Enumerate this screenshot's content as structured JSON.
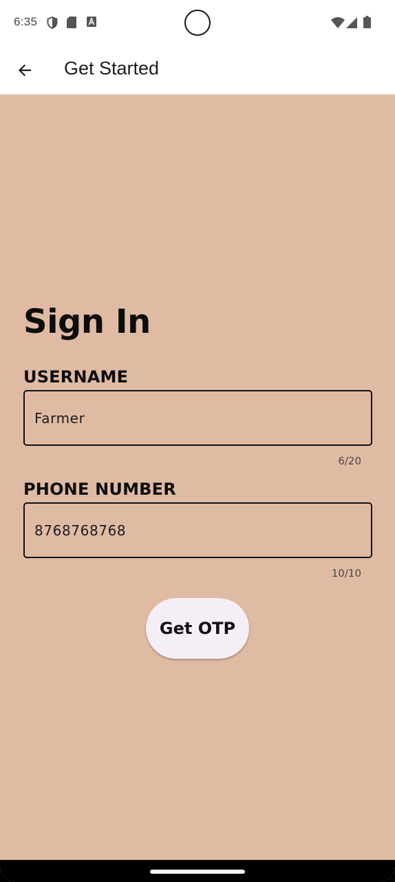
{
  "status_bar": {
    "time": "6:35",
    "left_icons": [
      "shield-icon",
      "sd-card-icon",
      "text-a-icon"
    ],
    "right_icons": [
      "wifi-icon",
      "signal-icon",
      "battery-icon"
    ]
  },
  "app_bar": {
    "back_icon": "arrow-back-icon",
    "title": "Get Started"
  },
  "form": {
    "heading": "Sign In",
    "username": {
      "label": "USERNAME",
      "value": "Farmer",
      "counter": "6/20"
    },
    "phone": {
      "label": "PHONE NUMBER",
      "value": "8768768768",
      "counter": "10/10"
    },
    "submit_label": "Get OTP"
  },
  "colors": {
    "background": "#e0bba3",
    "button_bg": "#f6eef7",
    "app_bar": "#ffffff"
  }
}
